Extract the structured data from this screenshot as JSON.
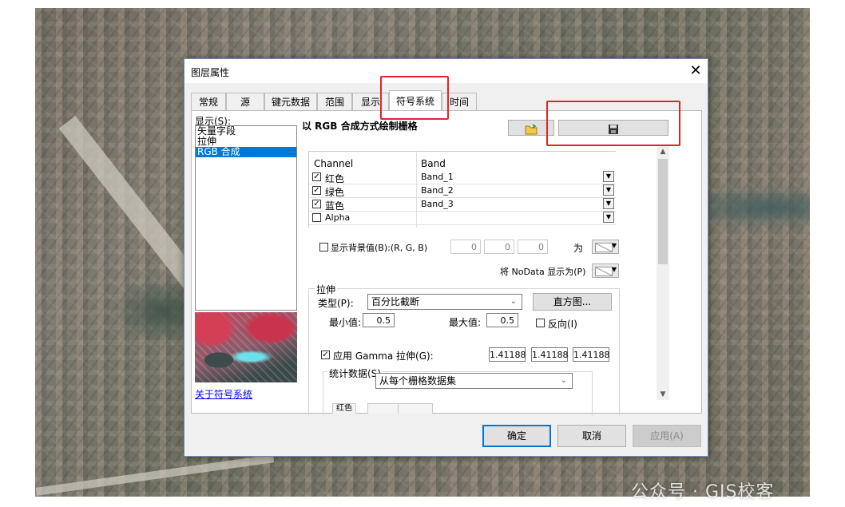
{
  "watermark": "公众号 · GIS校客",
  "dialog": {
    "title": "图层属性",
    "close_glyph": "✕",
    "tabs": [
      {
        "label": "常规"
      },
      {
        "label": "源"
      },
      {
        "label": "键元数据"
      },
      {
        "label": "范围"
      },
      {
        "label": "显示"
      },
      {
        "label": "符号系统",
        "active": true
      },
      {
        "label": "时间"
      }
    ],
    "show_label": "显示(S):",
    "renderers": [
      "矢量字段",
      "拉伸",
      "RGB 合成"
    ],
    "selected_renderer": "RGB 合成",
    "about_link": "关于符号系统",
    "heading": "以 RGB 合成方式绘制栅格",
    "toolbar_icons": [
      "open-folder-icon",
      "save-icon"
    ],
    "band_grid": {
      "headers": {
        "channel": "Channel",
        "band": "Band"
      },
      "rows": [
        {
          "channel": "红色",
          "band": "Band_1",
          "checked": true,
          "check_glyph": "✓"
        },
        {
          "channel": "绿色",
          "band": "Band_2",
          "checked": true,
          "check_glyph": "✓"
        },
        {
          "channel": "蓝色",
          "band": "Band_3",
          "checked": true,
          "check_glyph": "✓"
        },
        {
          "channel": "Alpha",
          "band": "",
          "checked": false,
          "check_glyph": ""
        }
      ]
    },
    "background": {
      "label": "显示背景值(B):(R, G, B)",
      "checked": false,
      "values": [
        "0",
        "0",
        "0"
      ],
      "as_label": "为"
    },
    "nodata_label": "将 NoData 显示为(P)",
    "stretch": {
      "group_label": "拉伸",
      "type_label": "类型(P):",
      "type_value": "百分比截断",
      "histogram_button": "直方图...",
      "min_label": "最小值:",
      "min_value": "0.5",
      "max_label": "最大值:",
      "max_value": "0.5",
      "invert_label": "反向(I)",
      "invert_checked": false,
      "gamma_label": "应用 Gamma 拉伸(G):",
      "gamma_checked": true,
      "gamma_values": [
        "1.41188",
        "1.41188",
        "1.41188"
      ],
      "stats_group_label": "统计数据(S)",
      "stats_value": "从每个栅格数据集",
      "partial_tab": "红色"
    },
    "buttons": {
      "ok": "确定",
      "cancel": "取消",
      "apply": "应用(A)"
    }
  }
}
